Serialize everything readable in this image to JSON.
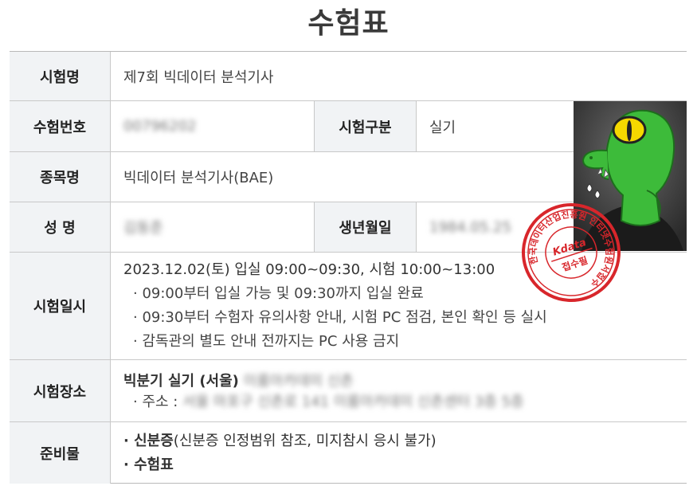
{
  "page_title": "수험표",
  "rows": {
    "exam_name": {
      "label": "시험명",
      "value": "제7회 빅데이터 분석기사"
    },
    "exam_number": {
      "label": "수험번호",
      "value": "00796202"
    },
    "exam_type": {
      "label": "시험구분",
      "value": "실기"
    },
    "subject": {
      "label": "종목명",
      "value": "빅데이터 분석기사(BAE)"
    },
    "name": {
      "label": "성 명",
      "value": "김동준"
    },
    "birth": {
      "label": "생년월일",
      "value": "1984.05.25"
    },
    "schedule": {
      "label": "시험일시",
      "main": "2023.12.02(토) 입실 09:00~09:30, 시험 10:00~13:00",
      "notes": [
        "· 09:00부터 입실 가능 및 09:30까지 입실 완료",
        "· 09:30부터 수험자 유의사항 안내, 시험 PC 점검, 본인 확인 등 실시",
        "· 감독관의 별도 안내 전까지는 PC 사용 금지"
      ]
    },
    "location": {
      "label": "시험장소",
      "main": "빅분기 실기 (서울)",
      "main_blurred": "이룸아카데미 신촌",
      "address_label": "· 주소 :",
      "address_blurred": "서울 마포구 신촌로 141 이룸아카데미 신촌센터 3층 5층"
    },
    "prep": {
      "label": "준비물",
      "item1_bold": "· 신분증",
      "item1_rest": "(신분증 인정범위 참조, 미지참시 응시 불가)",
      "item2": "· 수험표"
    }
  },
  "stamp": {
    "ring_text": "한국데이터산업진흥원 인터넷수험원서접수",
    "center_top": "Kdata",
    "center_bottom": "접수필"
  },
  "colors": {
    "header_bg": "#f1f3f5",
    "border": "#c8c8c8",
    "stamp_red": "#d8262b",
    "photo_green": "#3dbb3a"
  }
}
